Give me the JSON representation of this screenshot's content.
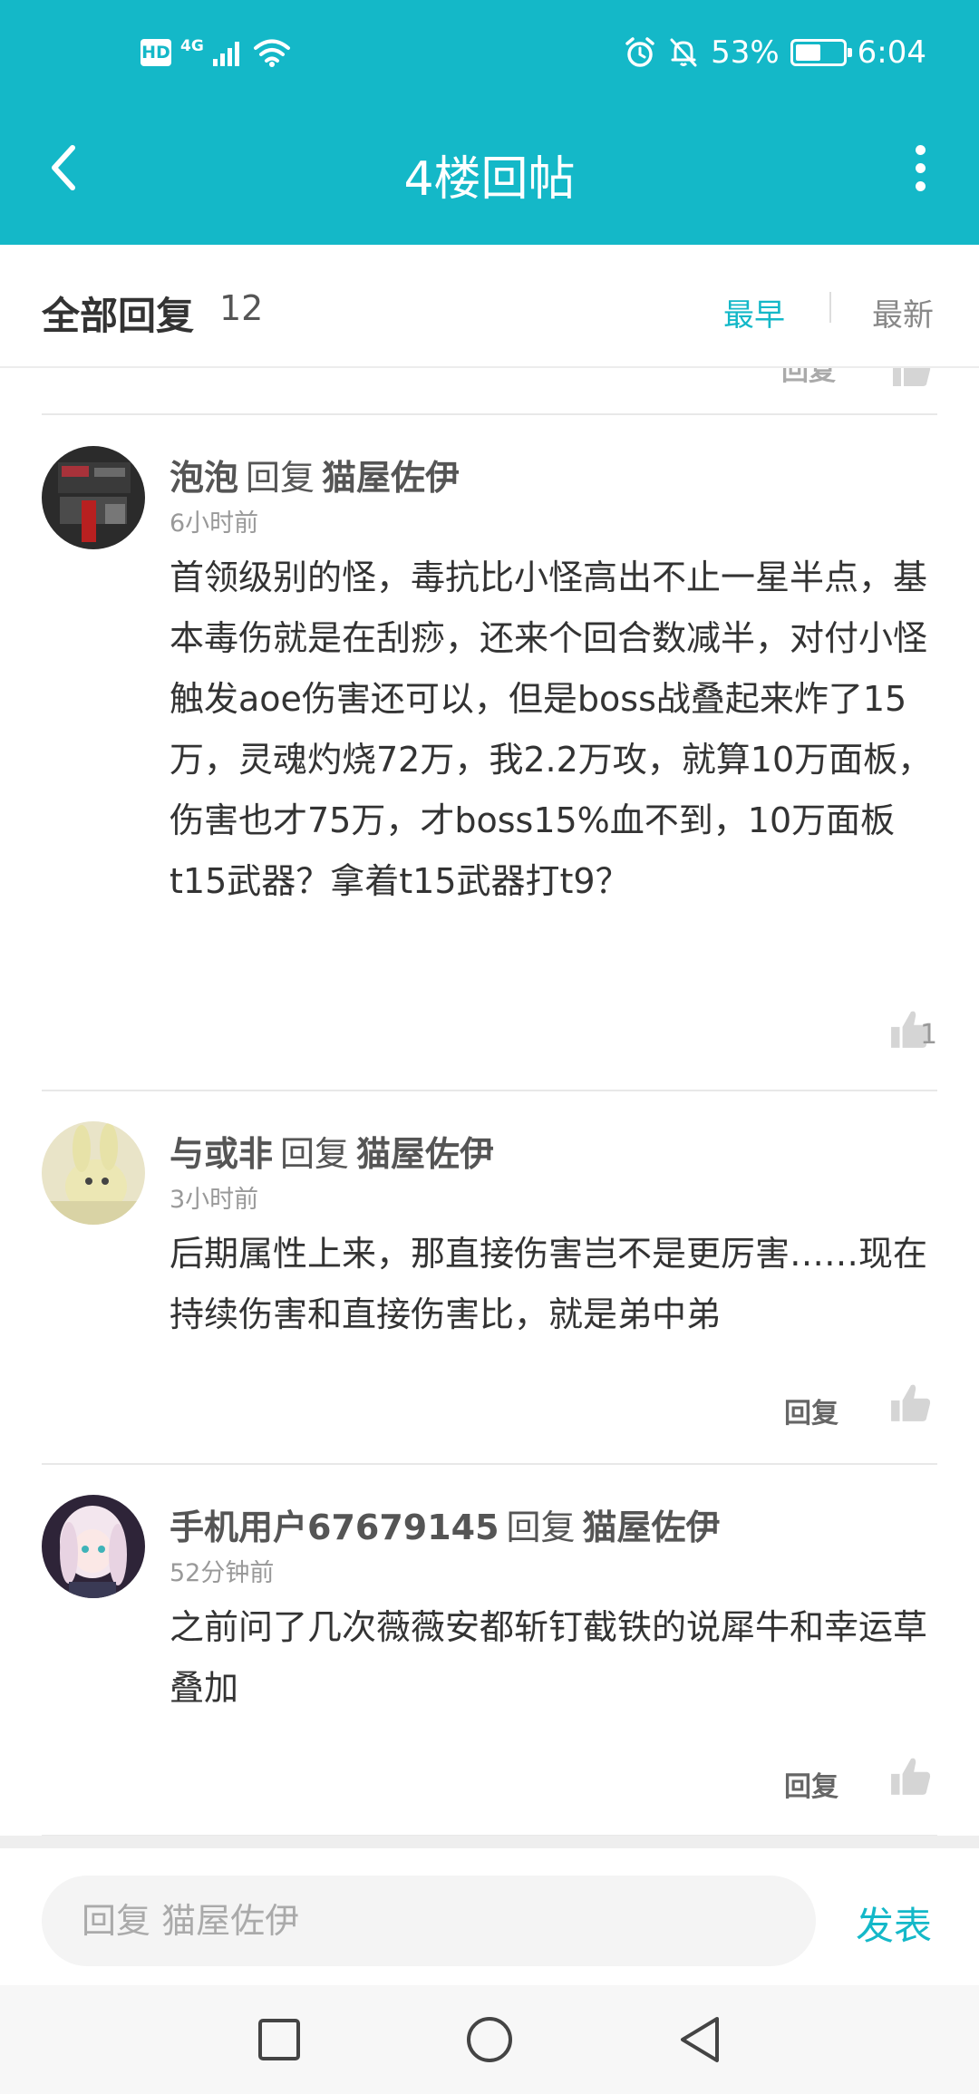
{
  "status_bar": {
    "hd_badge": "HD",
    "network": "4G",
    "battery_percent": "53%",
    "battery_level": 0.53,
    "time": "6:04"
  },
  "nav": {
    "title": "4楼回帖"
  },
  "filter": {
    "title": "全部回复",
    "count": "12",
    "sort_earliest": "最早",
    "sort_latest": "最新"
  },
  "partial_row": {
    "reply_label": "回复"
  },
  "replies": [
    {
      "author": "泡泡",
      "verb": "回复",
      "target": "猫屋佐伊",
      "time": "6小时前",
      "text": "首领级别的怪，毒抗比小怪高出不止一星半点，基本毒伤就是在刮痧，还来个回合数减半，对付小怪触发aoe伤害还可以，但是boss战叠起来炸了15万，灵魂灼烧72万，我2.2万攻，就算10万面板，伤害也才75万，才boss15%血不到，10万面板t15武器？拿着t15武器打t9？",
      "like_count": "1"
    },
    {
      "author": "与或非",
      "verb": "回复",
      "target": "猫屋佐伊",
      "time": "3小时前",
      "text": "后期属性上来，那直接伤害岂不是更厉害……现在持续伤害和直接伤害比，就是弟中弟",
      "reply_label": "回复"
    },
    {
      "author": "手机用户67679145",
      "verb": "回复",
      "target": "猫屋佐伊",
      "time": "52分钟前",
      "text": "之前问了几次薇薇安都斩钉截铁的说犀牛和幸运草叠加",
      "reply_label": "回复"
    }
  ],
  "input": {
    "placeholder": "回复 猫屋佐伊",
    "submit_label": "发表"
  },
  "colors": {
    "accent": "#14b8c8",
    "text_primary": "#333333",
    "text_secondary": "#999999"
  },
  "icons": [
    "back-arrow-icon",
    "more-vertical-icon",
    "alarm-icon",
    "bell-off-icon",
    "wifi-icon",
    "signal-icon",
    "battery-icon",
    "thumbs-up-icon",
    "square-icon",
    "circle-icon",
    "triangle-back-icon"
  ]
}
